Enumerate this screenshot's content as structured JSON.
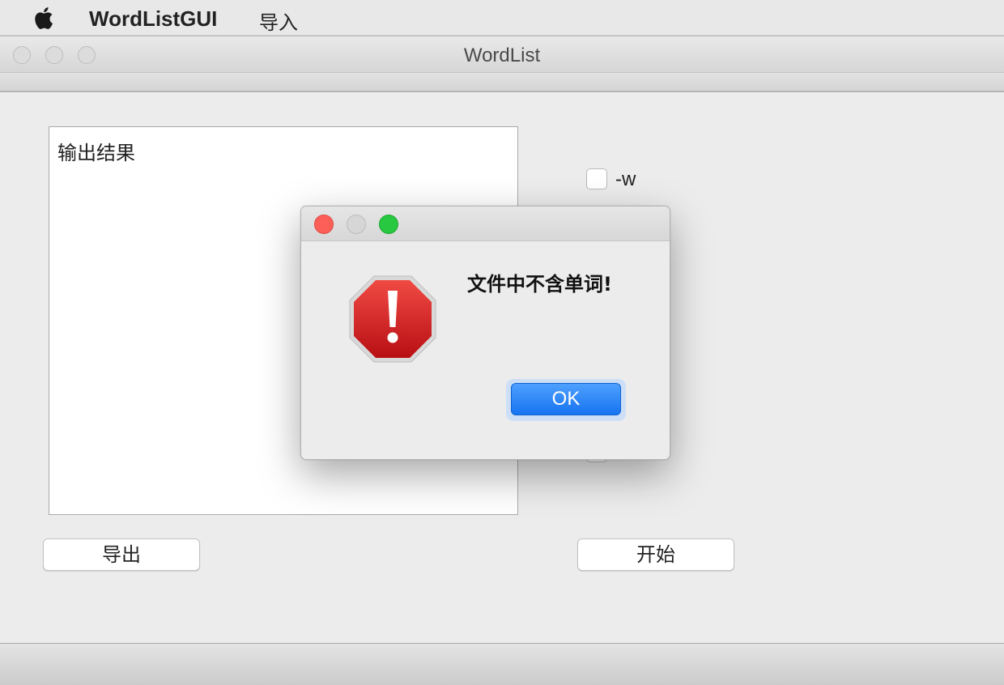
{
  "menubar": {
    "app_name": "WordListGUI",
    "menu_import": "导入"
  },
  "window": {
    "title": "WordList"
  },
  "main": {
    "output_text": "输出结果",
    "option_w_label": "-w",
    "export_button": "导出",
    "start_button": "开始"
  },
  "dialog": {
    "message": "文件中不含单词!",
    "ok_label": "OK",
    "icon": "stop-alert-icon"
  },
  "colors": {
    "ok_button": "#1674f0",
    "close_light": "#fc5f57",
    "zoom_light": "#28c840",
    "alert_red": "#c8161c"
  }
}
